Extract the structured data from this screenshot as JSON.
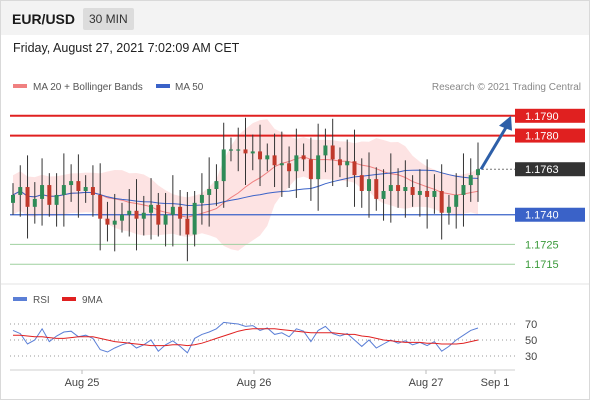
{
  "header": {
    "symbol": "EUR/USD",
    "timeframe": "30 MIN"
  },
  "timestamp": "Friday, August 27, 2021 7:02:09 AM CET",
  "legend": {
    "ma20": "MA 20 + Bollinger Bands",
    "ma50": "MA 50"
  },
  "credit": "Research © 2021 Trading Central",
  "colors": {
    "resistance": "#e02020",
    "support": "#3a62c8",
    "target": "#3a9a3a",
    "current": "#333333",
    "bull": "#2e8b57",
    "bear": "#c0392b",
    "ma20": "#f08080",
    "ma50": "#3a62c8",
    "rsi": "#5b7fd6",
    "rsi_ma": "#e02020",
    "arrow": "#2d5fa8",
    "band": "#fde0e0"
  },
  "chart_data": [
    {
      "type": "candlestick",
      "x": [
        "Aug 25",
        "Aug 26",
        "Aug 27",
        "Sep 1"
      ],
      "ylim": [
        1.1705,
        1.18
      ],
      "levels": [
        {
          "label": "1.1790",
          "value": 1.179,
          "kind": "resistance"
        },
        {
          "label": "1.1780",
          "value": 1.178,
          "kind": "resistance"
        },
        {
          "label": "1.1763",
          "value": 1.1763,
          "kind": "current"
        },
        {
          "label": "1.1740",
          "value": 1.174,
          "kind": "support"
        },
        {
          "label": "1.1725",
          "value": 1.1725,
          "kind": "target"
        },
        {
          "label": "1.1715",
          "value": 1.1715,
          "kind": "target"
        }
      ],
      "close": [
        1.175,
        1.1754,
        1.1744,
        1.1748,
        1.1755,
        1.1745,
        1.175,
        1.1755,
        1.1757,
        1.1752,
        1.1754,
        1.175,
        1.1738,
        1.1735,
        1.1737,
        1.174,
        1.1742,
        1.1738,
        1.1741,
        1.1745,
        1.1735,
        1.174,
        1.1744,
        1.1738,
        1.173,
        1.1746,
        1.175,
        1.1753,
        1.1757,
        1.1773,
        1.1773,
        1.1773,
        1.1771,
        1.1772,
        1.1768,
        1.177,
        1.1765,
        1.1766,
        1.1762,
        1.177,
        1.1768,
        1.1758,
        1.177,
        1.1775,
        1.1768,
        1.1765,
        1.1767,
        1.176,
        1.1752,
        1.1758,
        1.1748,
        1.1752,
        1.1755,
        1.1752,
        1.1754,
        1.175,
        1.1752,
        1.1749,
        1.1752,
        1.1741,
        1.1744,
        1.175,
        1.1755,
        1.176,
        1.1763
      ]
    },
    {
      "type": "line",
      "name": "RSI",
      "legend": [
        "RSI",
        "9MA"
      ],
      "x": [
        "Aug 25",
        "Aug 26",
        "Aug 27",
        "Sep 1"
      ],
      "ylim": [
        20,
        80
      ],
      "yticks": [
        30,
        50,
        70
      ],
      "rsi": [
        62,
        58,
        45,
        50,
        64,
        48,
        55,
        60,
        61,
        54,
        56,
        52,
        38,
        35,
        40,
        44,
        47,
        40,
        44,
        50,
        36,
        44,
        49,
        42,
        34,
        52,
        57,
        60,
        64,
        72,
        71,
        70,
        67,
        68,
        62,
        65,
        57,
        59,
        54,
        64,
        61,
        48,
        62,
        67,
        58,
        55,
        58,
        50,
        42,
        50,
        40,
        45,
        50,
        46,
        49,
        44,
        47,
        43,
        48,
        36,
        42,
        50,
        56,
        62,
        65
      ],
      "rsi_ma": [
        56,
        56,
        55,
        54,
        54,
        53,
        52,
        52,
        53,
        54,
        54,
        54,
        52,
        50,
        48,
        47,
        46,
        45,
        44,
        43,
        43,
        43,
        44,
        44,
        43,
        44,
        46,
        49,
        52,
        55,
        58,
        61,
        63,
        64,
        64,
        64,
        64,
        63,
        62,
        61,
        60,
        59,
        59,
        59,
        59,
        58,
        57,
        57,
        55,
        54,
        52,
        50,
        49,
        48,
        47,
        47,
        47,
        46,
        46,
        45,
        45,
        45,
        46,
        48,
        50
      ]
    }
  ]
}
